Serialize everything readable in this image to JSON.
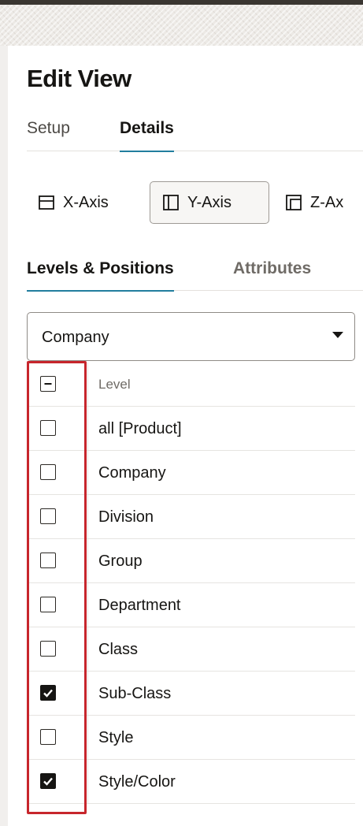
{
  "dialog": {
    "title": "Edit View"
  },
  "tabs": [
    {
      "label": "Setup",
      "active": false
    },
    {
      "label": "Details",
      "active": true
    }
  ],
  "axis_buttons": [
    {
      "label": "X-Axis",
      "icon": "x-axis-icon",
      "selected": false
    },
    {
      "label": "Y-Axis",
      "icon": "y-axis-icon",
      "selected": true
    },
    {
      "label": "Z-Ax",
      "icon": "z-axis-icon",
      "selected": false
    }
  ],
  "subtabs": [
    {
      "label": "Levels & Positions",
      "active": true
    },
    {
      "label": "Attributes",
      "active": false
    }
  ],
  "hierarchy_select": {
    "value": "Company",
    "icon": "caret-down-icon"
  },
  "levels": {
    "header": {
      "label": "Level",
      "state": "indeterminate"
    },
    "rows": [
      {
        "label": "all [Product]",
        "checked": false
      },
      {
        "label": "Company",
        "checked": false
      },
      {
        "label": "Division",
        "checked": false
      },
      {
        "label": "Group",
        "checked": false
      },
      {
        "label": "Department",
        "checked": false
      },
      {
        "label": "Class",
        "checked": false
      },
      {
        "label": "Sub-Class",
        "checked": true
      },
      {
        "label": "Style",
        "checked": false
      },
      {
        "label": "Style/Color",
        "checked": true
      }
    ]
  },
  "colors": {
    "accent_underline": "#227e9e",
    "highlight_box": "#c7262c",
    "text": "#161513"
  }
}
